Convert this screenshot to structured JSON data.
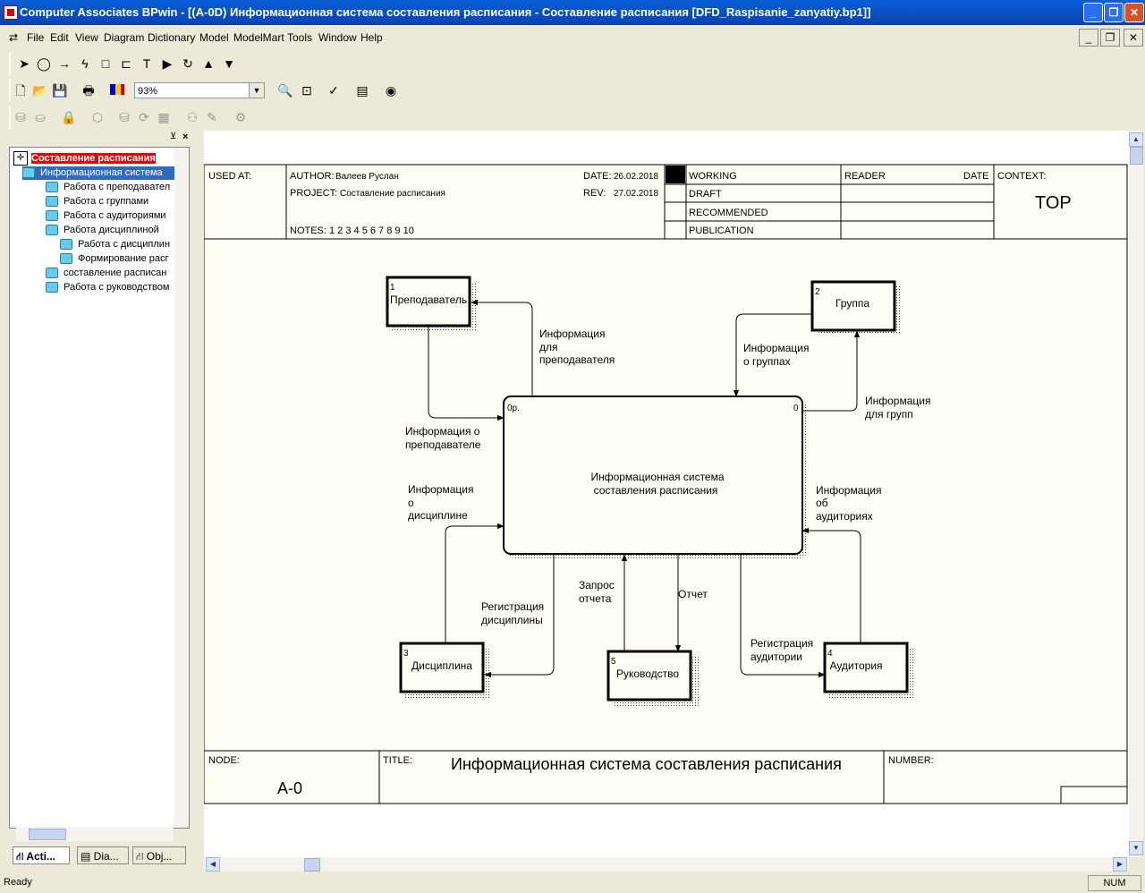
{
  "window": {
    "title": "Computer Associates BPwin - [(A-0D) Информационная система составления расписания - Составление расписания  [DFD_Raspisanie_zanyatiy.bp1]]",
    "buttons": [
      "_",
      "❐",
      "✕"
    ]
  },
  "menu": [
    "File",
    "Edit",
    "View",
    "Diagram",
    "Dictionary",
    "Model",
    "ModelMart",
    "Tools",
    "Window",
    "Help"
  ],
  "toolbar": {
    "zoom": "93%"
  },
  "tree": {
    "root": "Составление расписания",
    "items": [
      {
        "label": "Информационная система",
        "level": 1,
        "selected": true
      },
      {
        "label": "Работа с преподавател",
        "level": 2
      },
      {
        "label": "Работа с группами",
        "level": 2
      },
      {
        "label": "Работа с аудиториями",
        "level": 2
      },
      {
        "label": "Работа дисциплиной",
        "level": 2
      },
      {
        "label": "Работа с дисциплин",
        "level": 3
      },
      {
        "label": "Формирование расг",
        "level": 3
      },
      {
        "label": "составление расписан",
        "level": 2
      },
      {
        "label": "Работа с руководством",
        "level": 2
      }
    ]
  },
  "panel_tabs": [
    "Acti...",
    "Dia...",
    "Obj..."
  ],
  "header": {
    "used_at": "USED AT:",
    "author_label": "AUTHOR:",
    "author": "Валеев Руслан",
    "project_label": "PROJECT:",
    "project": "Составление расписания",
    "date_label": "DATE:",
    "date": "26.02.2018",
    "rev_label": "REV:",
    "rev": "27.02.2018",
    "notes": "NOTES:  1  2  3  4  5  6  7  8  9  10",
    "status": [
      "WORKING",
      "DRAFT",
      "RECOMMENDED",
      "PUBLICATION"
    ],
    "reader": "READER",
    "reader_date": "DATE",
    "context_label": "CONTEXT:",
    "context": "TOP"
  },
  "footer": {
    "node_label": "NODE:",
    "node": "A-0",
    "title_label": "TITLE:",
    "title": "Информационная система составления расписания",
    "number_label": "NUMBER:"
  },
  "diagram": {
    "process": {
      "num": "0р.",
      "corner": "0",
      "label1": "Информационная система",
      "label2": "составления расписания"
    },
    "entities": [
      {
        "num": "1",
        "label": "Преподаватель"
      },
      {
        "num": "2",
        "label": "Группа"
      },
      {
        "num": "3",
        "label": "Дисциплина"
      },
      {
        "num": "4",
        "label": "Аудитория"
      },
      {
        "num": "5",
        "label": "Руководство"
      }
    ],
    "flows": {
      "inf_for_teacher": [
        "Информация",
        "для",
        "преподавателя"
      ],
      "inf_about_teacher": [
        "Информация о",
        "преподавателе"
      ],
      "inf_about_groups": [
        "Информация",
        "о группах"
      ],
      "inf_for_groups": [
        "Информация",
        "для групп"
      ],
      "inf_about_discipline": [
        "Информация",
        "о",
        "дисциплине"
      ],
      "reg_discipline": [
        "Регистрация",
        "дисциплины"
      ],
      "inf_about_rooms": [
        "Информация",
        "об",
        "аудиториях"
      ],
      "reg_rooms": [
        "Регистрация",
        "аудитории"
      ],
      "report_request": [
        "Запрос",
        "отчета"
      ],
      "report": [
        "Отчет"
      ]
    }
  },
  "status": {
    "text": "Ready",
    "num": "NUM"
  }
}
